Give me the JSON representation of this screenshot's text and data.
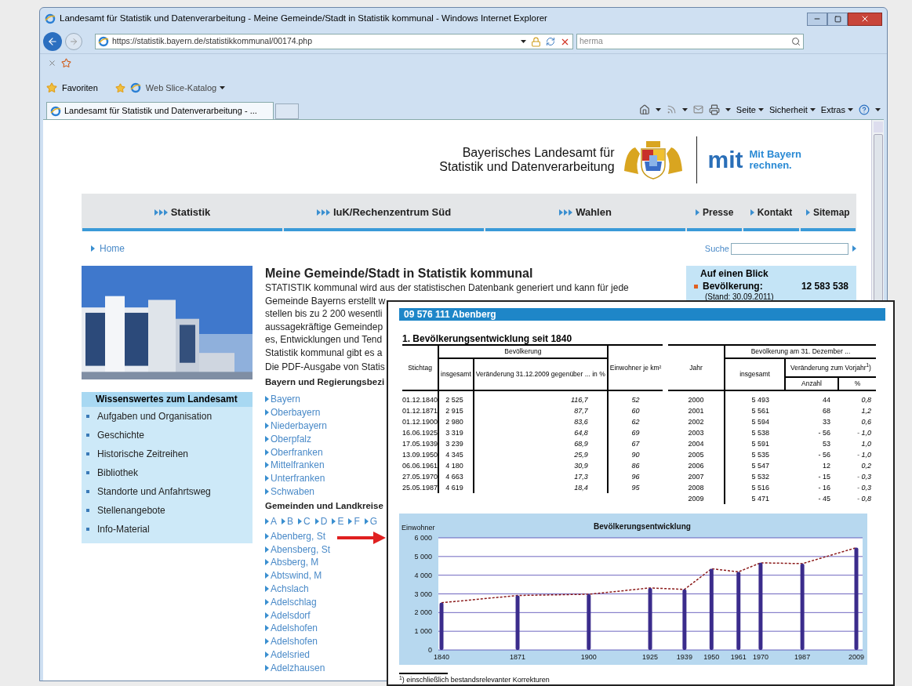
{
  "window": {
    "title": "Landesamt für Statistik und Datenverarbeitung - Meine Gemeinde/Stadt in Statistik kommunal - Windows Internet Explorer"
  },
  "address_bar": {
    "url": "https://statistik.bayern.de/statistikkommunal/00174.php"
  },
  "search_box": {
    "value": "herma"
  },
  "favorites_bar": {
    "favorites": "Favoriten",
    "web_slice": "Web Slice-Katalog"
  },
  "tabs": [
    {
      "title": "Landesamt für Statistik und Datenverarbeitung - ...",
      "selected": true
    }
  ],
  "command_bar": [
    "Seite",
    "Sicherheit",
    "Extras"
  ],
  "page": {
    "header": {
      "lines": [
        "Bayerisches Landesamt für",
        "Statistik und Datenverarbeitung"
      ],
      "logo_mark": "mit",
      "slogan": [
        "Mit Bayern",
        "rechnen."
      ]
    },
    "nav": [
      {
        "label": "Statistik",
        "kind": "main"
      },
      {
        "label": "IuK/Rechenzentrum Süd",
        "kind": "main"
      },
      {
        "label": "Wahlen",
        "kind": "main"
      },
      {
        "label": "Presse",
        "kind": "small"
      },
      {
        "label": "Kontakt",
        "kind": "small"
      },
      {
        "label": "Sitemap",
        "kind": "small"
      }
    ],
    "breadcrumb": "Home",
    "search_label": "Suche",
    "sidebar": {
      "title": "Wissenswertes zum Landesamt",
      "items": [
        "Aufgaben und Organisation",
        "Geschichte",
        "Historische Zeitreihen",
        "Bibliothek",
        "Standorte und Anfahrtsweg",
        "Stellenangebote",
        "Info-Material"
      ]
    },
    "main": {
      "heading": "Meine Gemeinde/Stadt in Statistik kommunal",
      "intro_lines": [
        "STATISTIK kommunal wird aus der statistischen Datenbank generiert und kann für jede",
        "Gemeinde Bayerns erstellt w",
        "stellen bis zu 2 200 wesentli",
        "aussagekräftige Gemeindep",
        "es, Entwicklungen und Tend",
        "Statistik kommunal gibt es a"
      ],
      "pdf_line": "Die PDF-Ausgabe von Statis",
      "regions_heading": "Bayern und Regierungsbezi",
      "regions": [
        "Bayern",
        "Oberbayern",
        "Niederbayern",
        "Oberpfalz",
        "Oberfranken",
        "Mittelfranken",
        "Unterfranken",
        "Schwaben"
      ],
      "communities_heading": "Gemeinden und Landkreise",
      "letters": [
        "A",
        "B",
        "C",
        "D",
        "E",
        "F",
        "G"
      ],
      "communities": [
        "Abenberg, St",
        "Abensberg, St",
        "Absberg, M",
        "Abtswind, M",
        "Achslach",
        "Adelschlag",
        "Adelsdorf",
        "Adelshofen",
        "Adelshofen",
        "Adelsried",
        "Adelzhausen"
      ]
    },
    "glance": {
      "title": "Auf einen Blick",
      "label": "Bevölkerung:",
      "value": "12 583 538",
      "note": "(Stand: 30.09.2011)"
    }
  },
  "document": {
    "title": "09 576 111 Abenberg",
    "section": "1. Bevölkerungsentwicklung seit 1840",
    "left_table": {
      "group": "Bevölkerung",
      "columns": [
        "Stichtag",
        "insgesamt",
        "Veränderung 31.12.2009 gegenüber ... in %",
        "Einwohner je km²"
      ],
      "rows": [
        [
          "01.12.1840",
          "2 525",
          "116,7",
          "52"
        ],
        [
          "01.12.1871",
          "2 915",
          "87,7",
          "60"
        ],
        [
          "01.12.1900",
          "2 980",
          "83,6",
          "62"
        ],
        [
          "16.06.1925",
          "3 319",
          "64,8",
          "69"
        ],
        [
          "17.05.1939",
          "3 239",
          "68,9",
          "67"
        ],
        [
          "13.09.1950",
          "4 345",
          "25,9",
          "90"
        ],
        [
          "06.06.1961",
          "4 180",
          "30,9",
          "86"
        ],
        [
          "27.05.1970",
          "4 663",
          "17,3",
          "96"
        ],
        [
          "25.05.1987",
          "4 619",
          "18,4",
          "95"
        ]
      ]
    },
    "right_table": {
      "group": "Bevölkerung am 31. Dezember ...",
      "change": "Veränderung zum Vorjahr$^{1}$)",
      "columns": [
        "Jahr",
        "insgesamt",
        "Anzahl",
        "%"
      ],
      "rows": [
        [
          "2000",
          "5 493",
          "44",
          "0,8"
        ],
        [
          "2001",
          "5 561",
          "68",
          "1,2"
        ],
        [
          "2002",
          "5 594",
          "33",
          "0,6"
        ],
        [
          "2003",
          "5 538",
          "- 56",
          "- 1,0"
        ],
        [
          "2004",
          "5 591",
          "53",
          "1,0"
        ],
        [
          "2005",
          "5 535",
          "- 56",
          "- 1,0"
        ],
        [
          "2006",
          "5 547",
          "12",
          "0,2"
        ],
        [
          "2007",
          "5 532",
          "- 15",
          "- 0,3"
        ],
        [
          "2008",
          "5 516",
          "- 16",
          "- 0,3"
        ],
        [
          "2009",
          "5 471",
          "- 45",
          "- 0,8"
        ]
      ]
    },
    "chart_data": {
      "type": "bar",
      "title": "Bevölkerungsentwicklung",
      "ylabel": "Einwohner",
      "categories": [
        "1840",
        "1871",
        "1900",
        "1925",
        "1939",
        "1950",
        "1961",
        "1970",
        "1987",
        "2009"
      ],
      "grid": true,
      "series": [
        {
          "color": "#3b2c8c",
          "values": [
            2525,
            2915,
            2980,
            3319,
            3239,
            4345,
            4180,
            4663,
            4619,
            5471
          ]
        }
      ],
      "ylim": [
        0,
        6000
      ],
      "yticks": [
        {
          "value": 0,
          "label": "0"
        },
        {
          "value": 1000,
          "label": "1 000"
        },
        {
          "value": 2000,
          "label": "2 000"
        },
        {
          "value": 3000,
          "label": "3 000"
        },
        {
          "value": 4000,
          "label": "4 000"
        },
        {
          "value": 5000,
          "label": "5 000"
        },
        {
          "value": 6000,
          "label": "6 000"
        }
      ]
    },
    "footnote": "$^{1}$) einschließlich bestandsrelevanter Korrekturen"
  }
}
